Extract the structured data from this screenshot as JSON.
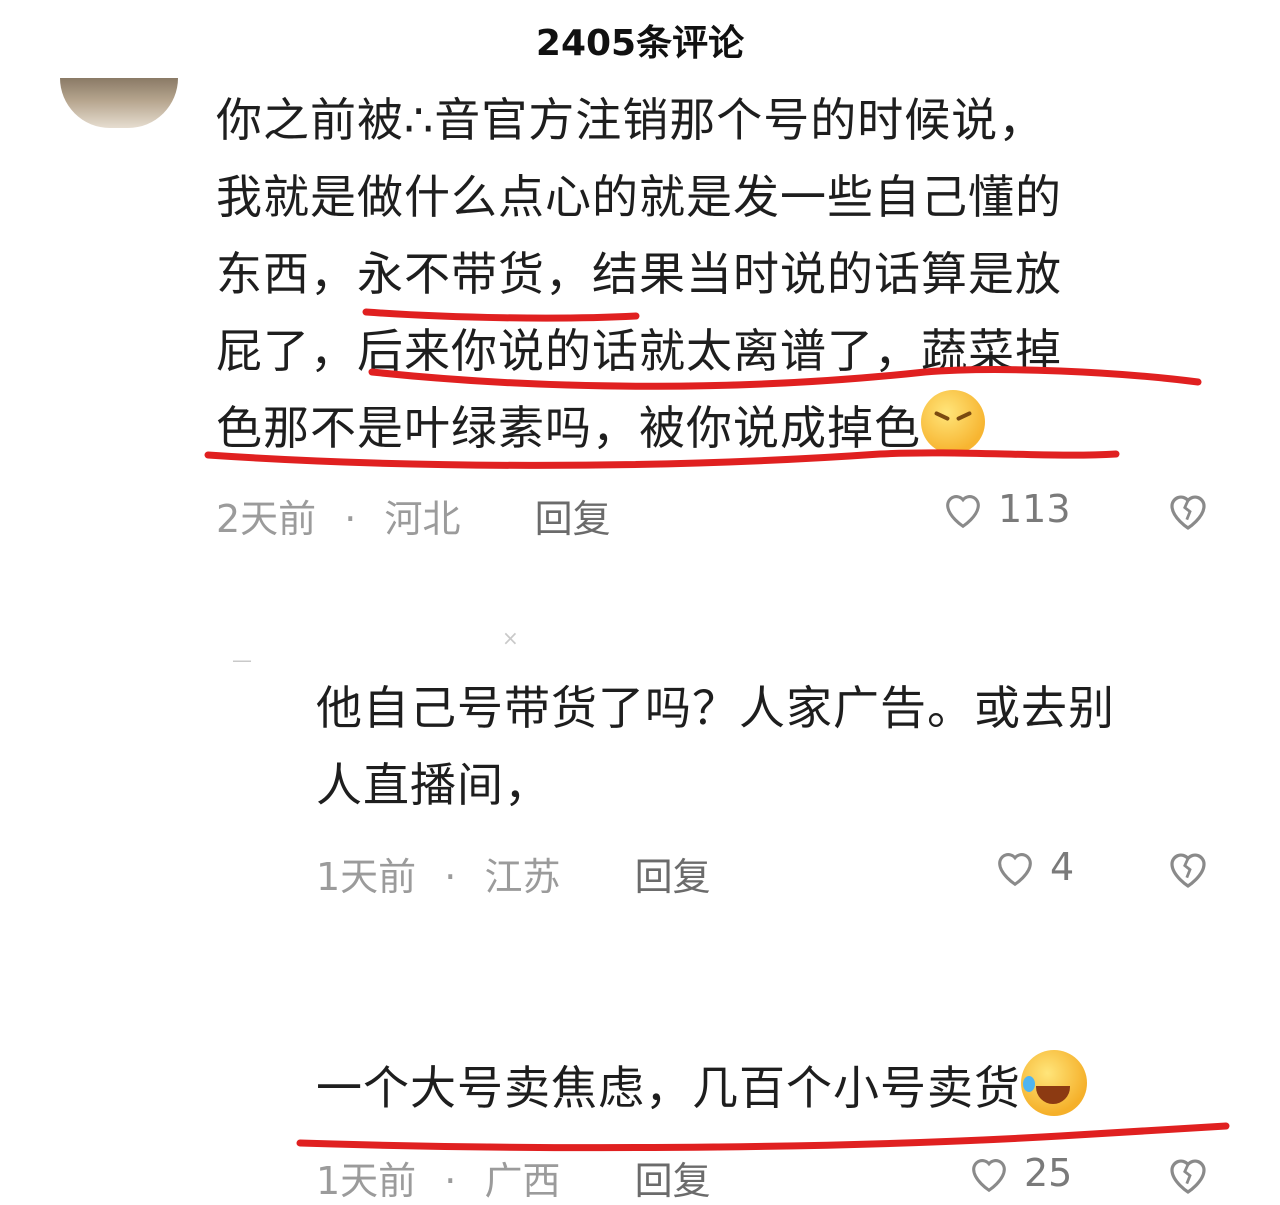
{
  "header": {
    "title": "2405条评论"
  },
  "comments": [
    {
      "lines": [
        "你之前被∴音官方注销那个号的时候说，",
        "我就是做什么点心的就是发一些自己懂的",
        "东西，永不带货，结果当时说的话算是放",
        "屁了，后来你说的话就太离谱了，蔬菜掉",
        "色那不是叶绿素吗，被你说成掉色"
      ],
      "time": "2天前",
      "location": "河北",
      "reply_label": "回复",
      "likes": "113"
    },
    {
      "lines": [
        "他自己号带货了吗？人家广告。或去别",
        "人直播间，"
      ],
      "time": "1天前",
      "location": "江苏",
      "reply_label": "回复",
      "likes": "4"
    },
    {
      "lines": [
        "一个大号卖焦虑，几百个小号卖货"
      ],
      "time": "1天前",
      "location": "广西",
      "reply_label": "回复",
      "likes": "25"
    }
  ],
  "colors": {
    "underline": "#e02020",
    "meta": "#9b9b9b"
  },
  "icons": [
    "heart-icon",
    "broken-heart-icon",
    "grimace-emoji",
    "laughing-crying-emoji"
  ]
}
